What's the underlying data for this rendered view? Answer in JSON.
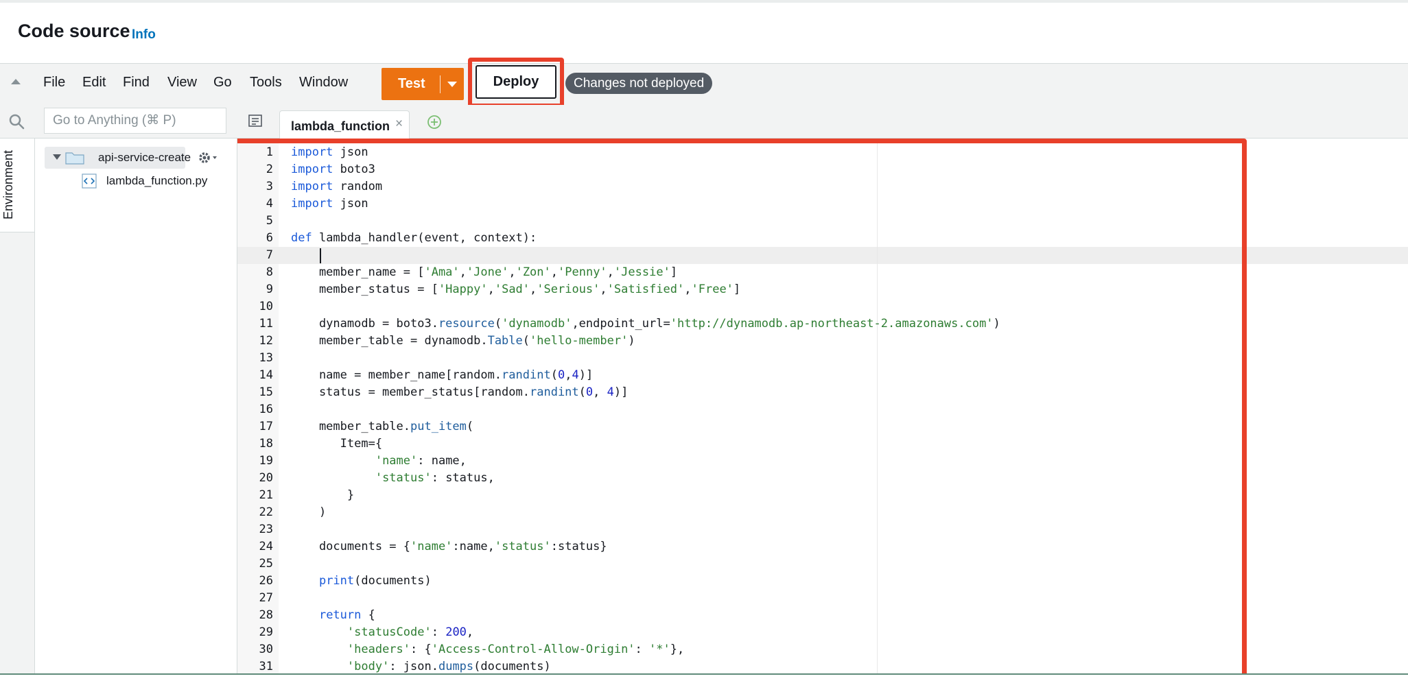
{
  "header": {
    "title": "Code source",
    "info_link": "Info"
  },
  "menu": {
    "items": [
      "File",
      "Edit",
      "Find",
      "View",
      "Go",
      "Tools",
      "Window"
    ],
    "test_button": "Test",
    "deploy_button": "Deploy",
    "status_badge": "Changes not deployed"
  },
  "search": {
    "placeholder": "Go to Anything (⌘ P)"
  },
  "sidebar": {
    "environment_tab": "Environment"
  },
  "file_tree": {
    "folder": "api-service-create",
    "file": "lambda_function.py"
  },
  "editor": {
    "tab_label": "lambda_function",
    "line_numbers": [
      "1",
      "2",
      "3",
      "4",
      "5",
      "6",
      "7",
      "8",
      "9",
      "10",
      "11",
      "12",
      "13",
      "14",
      "15",
      "16",
      "17",
      "18",
      "19",
      "20",
      "21",
      "22",
      "23",
      "24",
      "25",
      "26",
      "27",
      "28",
      "29",
      "30",
      "31"
    ],
    "lines": [
      "import json",
      "import boto3",
      "import random",
      "import json",
      "",
      "def lambda_handler(event, context):",
      "",
      "    member_name = ['Ama','Jone','Zon','Penny','Jessie']",
      "    member_status = ['Happy','Sad','Serious','Satisfied','Free']",
      "",
      "    dynamodb = boto3.resource('dynamodb',endpoint_url='http://dynamodb.ap-northeast-2.amazonaws.com')",
      "    member_table = dynamodb.Table('hello-member')",
      "",
      "    name = member_name[random.randint(0,4)]",
      "    status = member_status[random.randint(0, 4)]",
      "",
      "    member_table.put_item(",
      "       Item={",
      "            'name': name,",
      "            'status': status,",
      "        }",
      "    )",
      "",
      "    documents = {'name':name,'status':status}",
      "",
      "    print(documents)",
      "",
      "    return {",
      "        'statusCode': 200,",
      "        'headers': {'Access-Control-Allow-Origin': '*'},",
      "        'body': json.dumps(documents)"
    ]
  },
  "colors": {
    "accent_orange": "#ec7211",
    "highlight_red": "#e8402a",
    "badge_gray": "#545b64",
    "info_blue": "#0073bb",
    "keyword_blue": "#1a59d9",
    "string_green": "#2e7d32"
  },
  "icons": {
    "collapse": "triangle-up",
    "search": "magnifier",
    "tab_list": "list",
    "add_tab": "plus-circle",
    "folder": "folder",
    "gear": "gear",
    "file": "code-file"
  }
}
